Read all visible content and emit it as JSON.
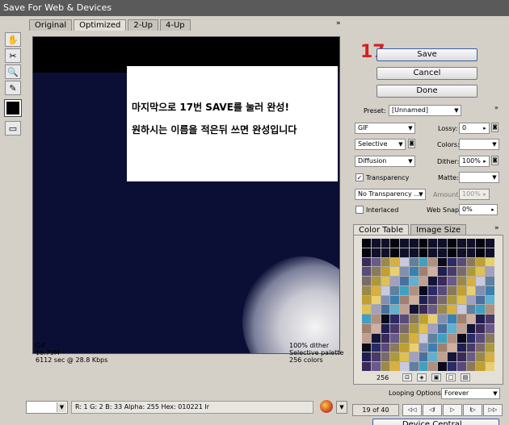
{
  "window": {
    "title": "Save For Web & Devices"
  },
  "tabs": [
    "Original",
    "Optimized",
    "2-Up",
    "4-Up"
  ],
  "tabs_more": "»",
  "tools": [
    {
      "icon": "hand-icon",
      "glyph": "✋"
    },
    {
      "icon": "slice-select-icon",
      "glyph": "✂"
    },
    {
      "icon": "zoom-icon",
      "glyph": "🔍"
    },
    {
      "icon": "eyedropper-icon",
      "glyph": "✎"
    },
    {
      "icon": "eyedropper-color-swatch",
      "glyph": ""
    },
    {
      "icon": "toggle-slices-icon",
      "glyph": "▭"
    }
  ],
  "overlay_note": {
    "line1": "마지막으로 17번 SAVE를 눌러 완성!",
    "line2": "원하시는 이름을 적은뒤 쓰면 완성입니다"
  },
  "image_info_left": [
    "GIF",
    "16.79M",
    "6112 sec @ 28.8 Kbps"
  ],
  "image_info_right": [
    "100% dither",
    "Selective palette",
    "256 colors"
  ],
  "annotation_number": "17",
  "buttons": {
    "save": "Save",
    "cancel": "Cancel",
    "done": "Done",
    "device_central": "Device Central..."
  },
  "settings": {
    "preset_label": "Preset:",
    "preset_value": "[Unnamed]",
    "format": "GIF",
    "lossy_label": "Lossy:",
    "lossy_value": "0",
    "reduction": "Selective",
    "colors_label": "Colors:",
    "colors_value": "",
    "dither_algo": "Diffusion",
    "dither_label": "Dither:",
    "dither_value": "100%",
    "transparency_label": "Transparency",
    "transparency_checked": true,
    "matte_label": "Matte:",
    "transparency_dither": "No Transparency ...",
    "amount_label": "Amount:",
    "amount_value": "100%",
    "interlaced_label": "Interlaced",
    "interlaced_checked": false,
    "websnap_label": "Web Snap:",
    "websnap_value": "0%"
  },
  "color_table": {
    "tabs": [
      "Color Table",
      "Image Size"
    ],
    "count": "256"
  },
  "looping": {
    "label": "Looping Options:",
    "value": "Forever"
  },
  "frames": {
    "counter": "19 of 40",
    "buttons": [
      "◁◁",
      "◁I",
      "▷",
      "I▷",
      "▷▷"
    ]
  },
  "status": {
    "zoom": "",
    "pixel_info": "R:    1    G:    2    B:    33    Alpha:  255   Hex:    010221   Ir"
  }
}
